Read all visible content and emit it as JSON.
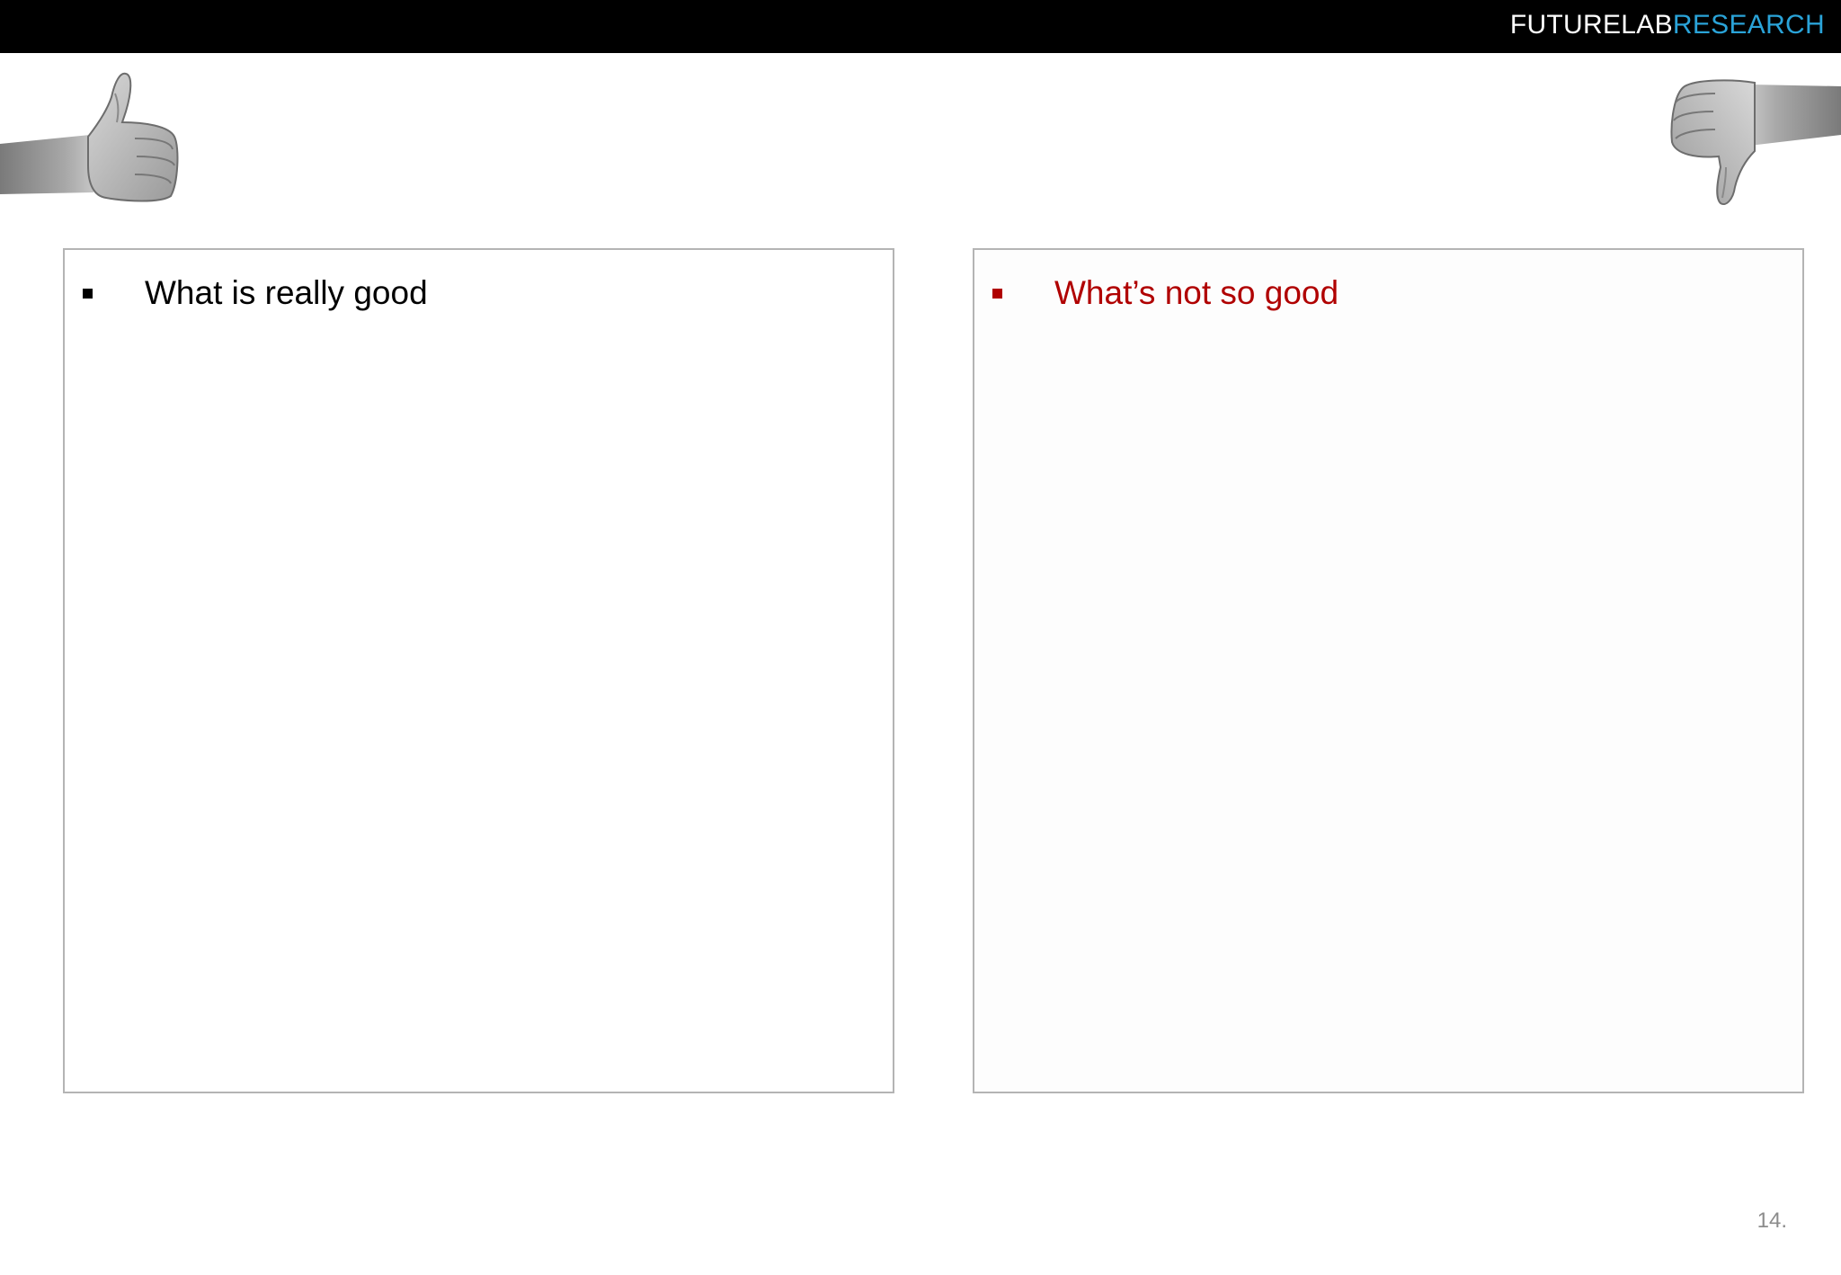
{
  "header": {
    "brand_part1": "FUTURELAB",
    "brand_part2": "RESEARCH",
    "brand_colors": {
      "part1": "#ffffff",
      "part2": "#2aa3d8",
      "bar": "#000000"
    }
  },
  "icons": {
    "left": "thumbs-up-icon",
    "right": "thumbs-down-icon"
  },
  "panels": {
    "good": {
      "label": "What is really good",
      "color": "#000000"
    },
    "bad": {
      "label": "What’s not so good",
      "color": "#b00000"
    }
  },
  "footer": {
    "page_number": "14."
  }
}
